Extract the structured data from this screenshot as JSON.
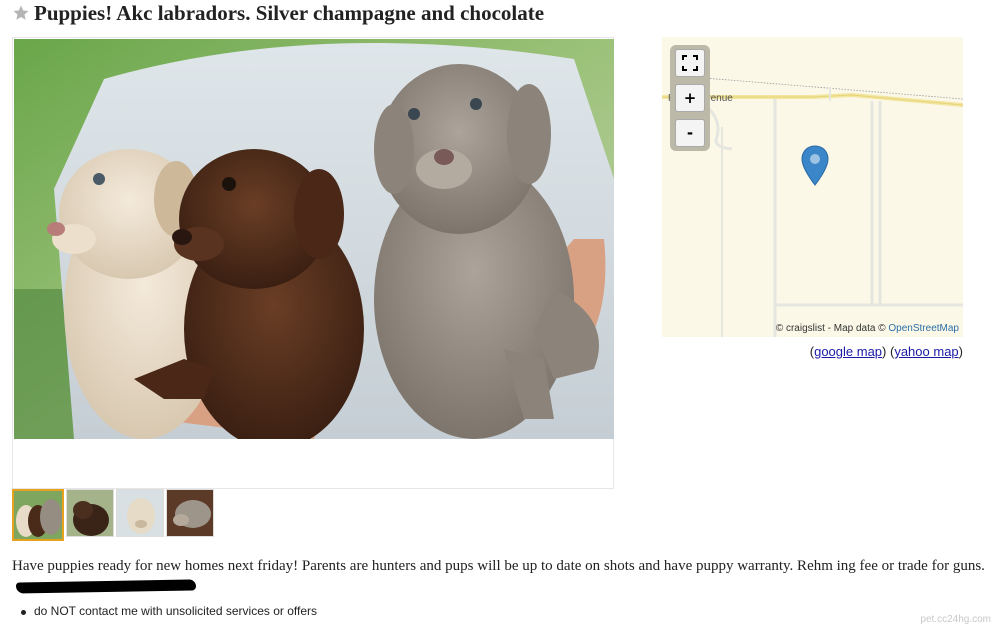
{
  "posting": {
    "title": "Puppies! Akc labradors. Silver champagne and chocolate",
    "star_icon": "star-icon",
    "body_text": "Have puppies ready for new homes next friday! Parents are hunters and pups will be up to date on shots and have puppy warranty. Rehm ing fee or trade for guns.",
    "notices": [
      "do NOT contact me with unsolicited services or offers"
    ]
  },
  "gallery": {
    "thumbnail_count": 4,
    "selected_index": 0
  },
  "map": {
    "road_label": "Ranch Avenue",
    "zoom_buttons": {
      "fullscreen_icon": "fullscreen-icon",
      "zoom_in": "+",
      "zoom_out": "-"
    },
    "attribution_prefix": "© craigslist - Map data ©",
    "attribution_link": "OpenStreetMap",
    "pin_icon": "map-pin-icon",
    "pin_color": "#3a86c8"
  },
  "map_links": {
    "open": "(",
    "google": "google map",
    "middle": ") (",
    "yahoo": "yahoo map",
    "close": ")"
  },
  "watermark": "pet.cc24hg.com",
  "colors": {
    "thumb_selected_border": "#e6a11f",
    "map_background": "#fbf8e8",
    "link_color": "#1a1aa6"
  }
}
